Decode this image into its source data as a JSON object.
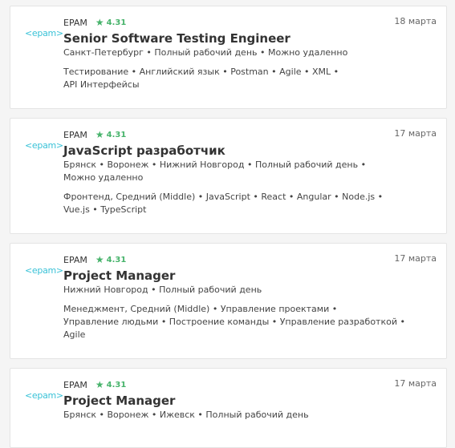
{
  "vacancies": [
    {
      "logo": "<epam>",
      "company": "EPAM",
      "rating": "4.31",
      "date": "18 марта",
      "title": "Senior Software Testing Engineer",
      "details": [
        "Санкт-Петербург • Полный рабочий день • Можно удаленно"
      ],
      "skills": [
        "Тестирование • Английский язык • Postman • Agile • XML •",
        "API Интерфейсы"
      ]
    },
    {
      "logo": "<epam>",
      "company": "EPAM",
      "rating": "4.31",
      "date": "17 марта",
      "title": "JavaScript разработчик",
      "details": [
        "Брянск • Воронеж • Нижний Новгород • Полный рабочий день •",
        "Можно удаленно"
      ],
      "skills": [
        "Фронтенд, Средний (Middle) • JavaScript • React • Angular • Node.js •",
        "Vue.js • TypeScript"
      ]
    },
    {
      "logo": "<epam>",
      "company": "EPAM",
      "rating": "4.31",
      "date": "17 марта",
      "title": "Project Manager",
      "details": [
        "Нижний Новгород • Полный рабочий день"
      ],
      "skills": [
        "Менеджмент, Средний (Middle) • Управление проектами •",
        "Управление людьми • Построение команды • Управление разработкой •",
        "Agile"
      ]
    },
    {
      "logo": "<epam>",
      "company": "EPAM",
      "rating": "4.31",
      "date": "17 марта",
      "title": "Project Manager",
      "details": [
        "Брянск • Воронеж • Ижевск • Полный рабочий день"
      ],
      "skills": []
    }
  ],
  "colors": {
    "rating": "#47b36b",
    "logo": "#39c2d7"
  },
  "icons": {
    "rating": "star-icon"
  }
}
